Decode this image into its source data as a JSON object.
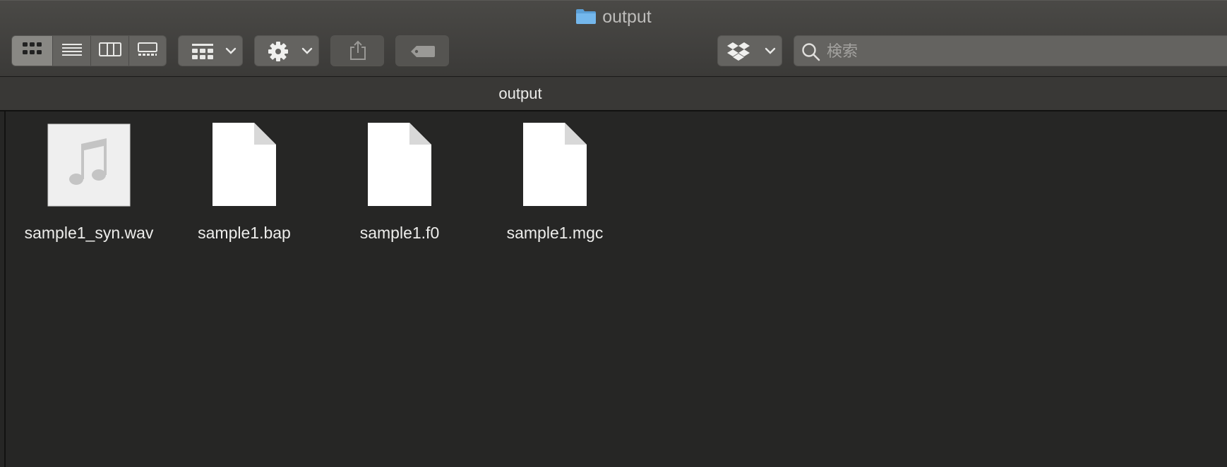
{
  "window": {
    "title": "output",
    "folder_icon": "folder-icon"
  },
  "toolbar": {
    "view_modes": [
      {
        "name": "icon-view",
        "icon": "grid-icon",
        "active": true
      },
      {
        "name": "list-view",
        "icon": "list-icon",
        "active": false
      },
      {
        "name": "column-view",
        "icon": "columns-icon",
        "active": false
      },
      {
        "name": "gallery-view",
        "icon": "gallery-icon",
        "active": false
      }
    ],
    "group_button_icon": "group-icon",
    "action_button_icon": "gear-icon",
    "share_button_icon": "share-icon",
    "tag_button_icon": "tag-icon",
    "dropbox_button_icon": "dropbox-icon",
    "search": {
      "placeholder": "検索",
      "value": ""
    }
  },
  "pathbar": {
    "title": "output"
  },
  "files": [
    {
      "name": "sample1_syn.wav",
      "type": "audio",
      "icon": "audio-file-icon"
    },
    {
      "name": "sample1.bap",
      "type": "document",
      "icon": "document-file-icon"
    },
    {
      "name": "sample1.f0",
      "type": "document",
      "icon": "document-file-icon"
    },
    {
      "name": "sample1.mgc",
      "type": "document",
      "icon": "document-file-icon"
    }
  ],
  "colors": {
    "window_bg": "#262625",
    "toolbar_bg": "#3b3a38",
    "button_bg": "#646360",
    "active_button_bg": "#898884",
    "folder_blue": "#6aaee3",
    "text": "#ededeb"
  }
}
